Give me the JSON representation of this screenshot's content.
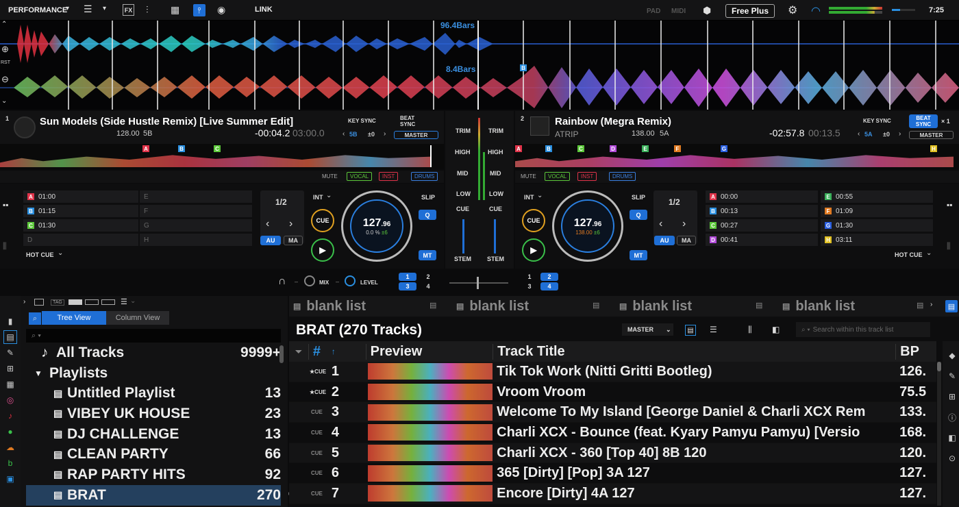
{
  "topbar": {
    "mode": "PERFORMANCE",
    "link": "LINK",
    "pad": "PAD",
    "midi": "MIDI",
    "free_plus": "Free Plus",
    "time": "7:25"
  },
  "waveform": {
    "bars_top": "96.4Bars",
    "bars_bottom": "8.4Bars",
    "rst": "RST",
    "marker_b": "B"
  },
  "deck1": {
    "num": "1",
    "title": "Sun Models (Side Hustle Remix) [Live Summer Edit]",
    "bpm": "128.00",
    "key": "5B",
    "elapsed": "-00:04.2",
    "remain": "03:00.0",
    "key_sync": "KEY SYNC",
    "key_val": "5B",
    "key_shift": "±0",
    "beat_sync": "BEAT SYNC",
    "master": "MASTER",
    "mute": "MUTE",
    "vocal": "VOCAL",
    "inst": "INST",
    "drums": "DRUMS",
    "cues": [
      {
        "l": "A",
        "t": "01:00",
        "c": "#e0334a"
      },
      {
        "l": "B",
        "t": "01:15",
        "c": "#2a8fe0"
      },
      {
        "l": "C",
        "t": "01:30",
        "c": "#5cc83a"
      },
      {
        "l": "D",
        "t": "",
        "c": "#333"
      }
    ],
    "cues2": [
      "E",
      "F",
      "G",
      "H"
    ],
    "hotcue": "HOT CUE",
    "loop": "1/2",
    "int": "INT",
    "cue": "CUE",
    "slip": "SLIP",
    "q": "Q",
    "au": "AU",
    "ma": "MA",
    "mt": "MT",
    "jog_bpm": "127",
    "jog_dec": ".96",
    "jog_pct": "0.0 %",
    "jog_pm": "±6"
  },
  "deck2": {
    "num": "2",
    "title": "Rainbow (Megra Remix)",
    "artist": "ATRIP",
    "bpm": "138.00",
    "key": "5A",
    "elapsed": "-02:57.8",
    "remain": "00:13.5",
    "key_sync": "KEY SYNC",
    "key_val": "5A",
    "key_shift": "±0",
    "beat_sync": "BEAT SYNC",
    "x1": "× 1",
    "master": "MASTER",
    "mute": "MUTE",
    "vocal": "VOCAL",
    "inst": "INST",
    "drums": "DRUMS",
    "cues": [
      {
        "l": "A",
        "t": "00:00",
        "c": "#e0334a"
      },
      {
        "l": "B",
        "t": "00:13",
        "c": "#2a8fe0"
      },
      {
        "l": "C",
        "t": "00:27",
        "c": "#5cc83a"
      },
      {
        "l": "D",
        "t": "00:41",
        "c": "#b04ad8"
      }
    ],
    "cues2": [
      {
        "l": "E",
        "t": "00:55",
        "c": "#3ab05a"
      },
      {
        "l": "F",
        "t": "01:09",
        "c": "#e07a22"
      },
      {
        "l": "G",
        "t": "01:30",
        "c": "#2a5fe0"
      },
      {
        "l": "H",
        "t": "03:11",
        "c": "#e0c022"
      }
    ],
    "hotcue": "HOT CUE",
    "loop": "1/2",
    "int": "INT",
    "cue": "CUE",
    "slip": "SLIP",
    "q": "Q",
    "au": "AU",
    "ma": "MA",
    "mt": "MT",
    "jog_bpm": "127",
    "jog_dec": ".96",
    "jog_pct": "138.00",
    "jog_pm": "±6"
  },
  "mixer": {
    "trim": "TRIM",
    "high": "HIGH",
    "mid": "MID",
    "low": "LOW",
    "cue": "CUE",
    "stem": "STEM",
    "mix": "MIX",
    "level": "LEVEL",
    "dash": "–",
    "fx": [
      "1",
      "2",
      "3",
      "4"
    ]
  },
  "browser": {
    "tag": "TAG",
    "tree_view": "Tree View",
    "column_view": "Column View",
    "all_tracks": "All Tracks",
    "all_count": "9999+",
    "playlists": "Playlists",
    "lists": [
      {
        "name": "Untitled Playlist",
        "count": "13"
      },
      {
        "name": "VIBEY UK HOUSE",
        "count": "23"
      },
      {
        "name": "DJ CHALLENGE",
        "count": "13"
      },
      {
        "name": "CLEAN PARTY",
        "count": "66"
      },
      {
        "name": "RAP PARTY HITS",
        "count": "92"
      },
      {
        "name": "BRAT",
        "count": "270"
      }
    ],
    "tabs": [
      "blank list",
      "blank list",
      "blank list",
      "blank list"
    ],
    "list_title": "BRAT (270 Tracks)",
    "master": "MASTER",
    "search_placeholder": "Search within this track list",
    "headers": {
      "num": "#",
      "preview": "Preview",
      "title": "Track Title",
      "bpm": "BP"
    },
    "tracks": [
      {
        "cue": "★CUE",
        "n": "1",
        "title": "Tik Tok Work (Nitti Gritti Bootleg)",
        "bpm": "126."
      },
      {
        "cue": "★CUE",
        "n": "2",
        "title": "Vroom Vroom",
        "bpm": "75.5"
      },
      {
        "cue": "CUE",
        "n": "3",
        "title": "Welcome To My Island [George Daniel & Charli XCX Rem",
        "bpm": "133."
      },
      {
        "cue": "CUE",
        "n": "4",
        "title": "Charli XCX - Bounce (feat. Kyary Pamyu Pamyu) [Versio",
        "bpm": "168."
      },
      {
        "cue": "CUE",
        "n": "5",
        "title": "Charli XCX - 360 [Top 40] 8B 120",
        "bpm": "120."
      },
      {
        "cue": "CUE",
        "n": "6",
        "title": "365 [Dirty] [Pop] 3A 127",
        "bpm": "127."
      },
      {
        "cue": "CUE",
        "n": "7",
        "title": "Encore [Dirty] 4A 127",
        "bpm": "127."
      }
    ]
  }
}
